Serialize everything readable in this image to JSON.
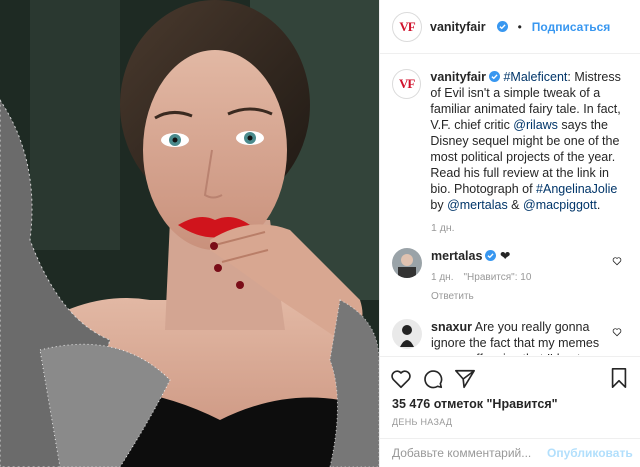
{
  "post": {
    "author": "vanityfair",
    "follow_label": "Подписаться",
    "dot": "•",
    "caption": {
      "author": "vanityfair",
      "hashtag_maleficent": "#Maleficent",
      "text_1": ": Mistress of Evil isn't a simple tweak of a familiar animated fairy tale. In fact, V.F. chief critic ",
      "mention_rilaws": "@rilaws",
      "text_2": " says the Disney sequel might be one of the most political projects of the year. Read his full review at the link in bio. Photograph of ",
      "hashtag_jolie": "#AngelinaJolie",
      "text_3": " by ",
      "mention_mertalas": "@mertalas",
      "text_4": " & ",
      "mention_macpiggott": "@macpiggott",
      "text_5": ".",
      "time": "1 дн."
    },
    "comments": [
      {
        "author": "mertalas",
        "text": "❤",
        "time": "1 дн.",
        "likes": "\"Нравится\": 10",
        "reply": "Ответить"
      },
      {
        "author": "snaxur",
        "text": "Are you really gonna ignore the fact that my memes are so offensive that I'd get banned if I was public"
      }
    ],
    "likes": "35 476 отметок \"Нравится\"",
    "date": "ДЕНЬ НАЗАД",
    "comment_placeholder": "Добавьте комментарий...",
    "publish_label": "Опубликовать"
  },
  "icons": {
    "like": "heart-icon",
    "comment": "comment-icon",
    "share": "share-icon",
    "save": "bookmark-icon"
  },
  "colors": {
    "link": "#003569",
    "follow": "#3897f0",
    "brand": "#d0122c"
  }
}
